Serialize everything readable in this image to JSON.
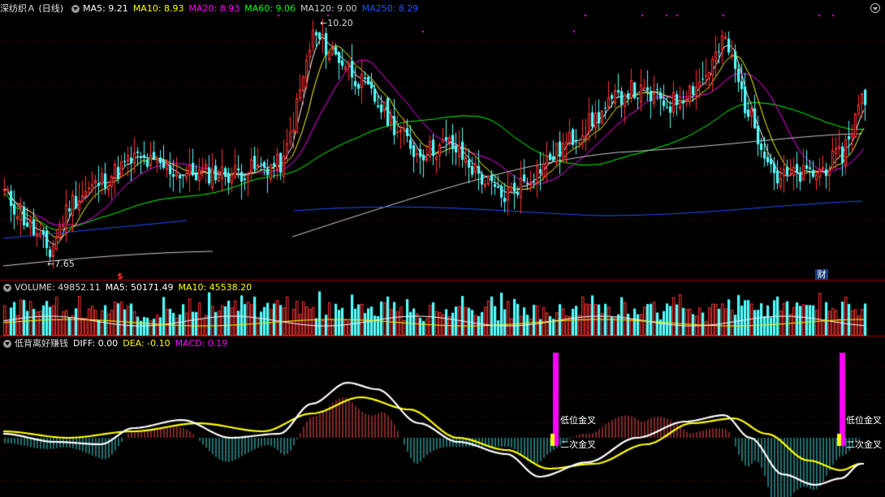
{
  "header": {
    "stock_title": "深纺织Ａ (日线)",
    "ma5": "MA5: 9.21",
    "ma10": "MA10: 8.93",
    "ma20": "MA20: 8.93",
    "ma60": "MA60: 9.06",
    "ma120": "MA120: 9.00",
    "ma250": "MA250: 8.29"
  },
  "price_panel": {
    "high_label": "←10.20",
    "low_label": "←7.65",
    "signal_mark": "$",
    "finance_badge": "财"
  },
  "volume_panel": {
    "title": "VOLUME: 49852.11",
    "ma5": "MA5: 50171.49",
    "ma10": "MA10: 45538.20"
  },
  "macd_panel": {
    "title": "低背离好赚钱",
    "diff": "DIFF: 0.00",
    "dea": "DEA: -0.10",
    "macd": "MACD: 0.19",
    "signal1_top": "低位金叉",
    "signal1_bottom": "二次金叉",
    "signal2_top": "低位金叉",
    "signal2_bottom": "二次金叉"
  },
  "colors": {
    "up": "#ff3232",
    "down": "#54ffff",
    "ma5": "#ffffff",
    "ma10": "#ffff00",
    "ma20": "#ff00ff",
    "ma60": "#00ff00",
    "ma120": "#cccccc",
    "ma250": "#2050ff",
    "dea": "#ffff00",
    "diff": "#ffffff",
    "signal": "#ff00ff"
  },
  "chart_data": [
    {
      "type": "candlestick",
      "title": "深纺织Ａ (日线)",
      "y_range": [
        7.65,
        10.2
      ],
      "anchors": [
        {
          "i": 0,
          "close": 8.4
        },
        {
          "i": 14,
          "close": 7.8
        },
        {
          "i": 20,
          "close": 8.3
        },
        {
          "i": 40,
          "close": 8.75
        },
        {
          "i": 55,
          "close": 8.6
        },
        {
          "i": 70,
          "close": 8.6
        },
        {
          "i": 86,
          "close": 8.7
        },
        {
          "i": 95,
          "close": 10.0
        },
        {
          "i": 105,
          "close": 9.7
        },
        {
          "i": 115,
          "close": 9.3
        },
        {
          "i": 127,
          "close": 8.8
        },
        {
          "i": 137,
          "close": 8.9
        },
        {
          "i": 153,
          "close": 8.35
        },
        {
          "i": 161,
          "close": 8.55
        },
        {
          "i": 180,
          "close": 9.1
        },
        {
          "i": 192,
          "close": 9.45
        },
        {
          "i": 205,
          "close": 9.3
        },
        {
          "i": 215,
          "close": 9.55
        },
        {
          "i": 222,
          "close": 9.95
        },
        {
          "i": 228,
          "close": 9.3
        },
        {
          "i": 238,
          "close": 8.55
        },
        {
          "i": 250,
          "close": 8.6
        },
        {
          "i": 258,
          "close": 8.8
        },
        {
          "i": 264,
          "close": 9.35
        }
      ]
    },
    {
      "type": "bar",
      "title": "VOLUME",
      "y_range": [
        0,
        100000
      ]
    },
    {
      "type": "line",
      "title": "低背离好赚钱",
      "series": [
        {
          "name": "DIFF"
        },
        {
          "name": "DEA"
        },
        {
          "name": "MACD"
        }
      ]
    }
  ]
}
